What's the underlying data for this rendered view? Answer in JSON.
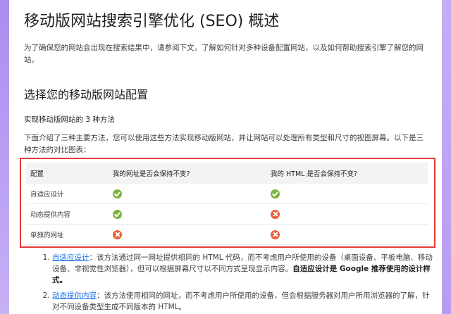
{
  "page": {
    "title": "移动版网站搜索引擎优化 (SEO) 概述",
    "intro": "为了确保您的网站会出现在搜索结果中，请参阅下文，了解如何针对多种设备配置网站，以及如何帮助搜索引擎了解您的网站。",
    "section_title": "选择您的移动版网站配置",
    "subhead": "实现移动版网站的 3 种方法",
    "desc": "下面介绍了三种主要方法，您可以使用这些方法实现移动版网站，并让网站可以处理所有类型和尺寸的视图屏幕。以下是三种方法的对比图表："
  },
  "table": {
    "headers": [
      "配置",
      "我的网址是否会保持不变?",
      "我的 HTML 是否会保持不变?"
    ],
    "rows": [
      {
        "label": "自适应设计",
        "url_same": "check-icon",
        "html_same": "check-icon"
      },
      {
        "label": "动态提供内容",
        "url_same": "check-icon",
        "html_same": "cross-icon"
      },
      {
        "label": "单独的网址",
        "url_same": "cross-icon",
        "html_same": "cross-icon"
      }
    ]
  },
  "methods": [
    {
      "link": "自适应设计",
      "text": "：该方法通过同一网址提供相同的 HTML 代码，而不考虑用户所使用的设备（桌面设备、平板电脑、移动设备、非视觉性浏览器），但可以根据屏幕尺寸以不同方式呈现显示内容。",
      "strong": "自适应设计是 Google 推荐使用的设计样式。"
    },
    {
      "link": "动态提供内容",
      "text": "：该方法使用相同的网址，而不考虑用户所使用的设备，但会根据服务器对用户所用浏览器的了解，针对不同设备类型生成不同版本的 HTML。",
      "strong": ""
    }
  ],
  "colors": {
    "accent_link": "#1a73e8",
    "highlight_border": "#e53935",
    "check": "#7cb342",
    "cross": "#e8643a",
    "background_gradient": "#b79cf2"
  }
}
